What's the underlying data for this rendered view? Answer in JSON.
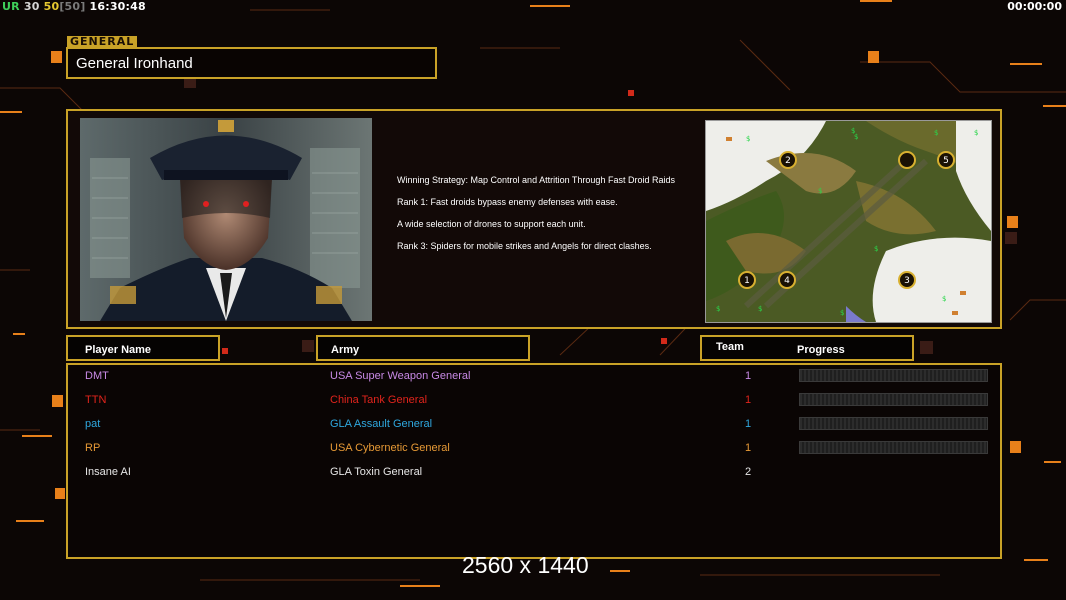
{
  "hud": {
    "ur_label": "UR",
    "ur_val1": "30",
    "ur_val2": "50",
    "ur_val3": "[50]",
    "clock": "16:30:48",
    "timer": "00:00:00"
  },
  "general": {
    "tag": "GENERAL",
    "name": "General Ironhand"
  },
  "strategy": [
    "Winning Strategy: Map Control and Attrition Through Fast Droid Raids",
    "Rank 1: Fast droids bypass enemy defenses with ease.",
    "A wide selection of drones to support each unit.",
    "Rank 3: Spiders for mobile strikes and Angels for direct clashes."
  ],
  "map": {
    "start_positions": [
      "1",
      "2",
      "3",
      "4",
      "5"
    ]
  },
  "headers": {
    "player": "Player Name",
    "army": "Army",
    "team": "Team",
    "progress": "Progress"
  },
  "players": [
    {
      "name": "DMT",
      "army": "USA Super Weapon General",
      "team": "1",
      "color": "#c88ae6",
      "progress": 0
    },
    {
      "name": "TTN",
      "army": "China Tank General",
      "team": "1",
      "color": "#e0241c",
      "progress": 0
    },
    {
      "name": "pat",
      "army": "GLA Assault General",
      "team": "1",
      "color": "#2fa7de",
      "progress": 0
    },
    {
      "name": "RP",
      "army": "USA Cybernetic General",
      "team": "1",
      "color": "#e79a36",
      "progress": 0
    },
    {
      "name": "Insane AI",
      "army": "GLA Toxin General",
      "team": "2",
      "color": "#e6e6e6"
    }
  ],
  "resolution": "2560 x 1440",
  "colors": {
    "accent_gold": "#c9a227",
    "hud_ur": "#3fd05a",
    "hud_30": "#d6d6d6",
    "hud_50": "#e6c830",
    "hud_bracket": "#7a7a7a",
    "deco_orange": "#e8801a"
  }
}
